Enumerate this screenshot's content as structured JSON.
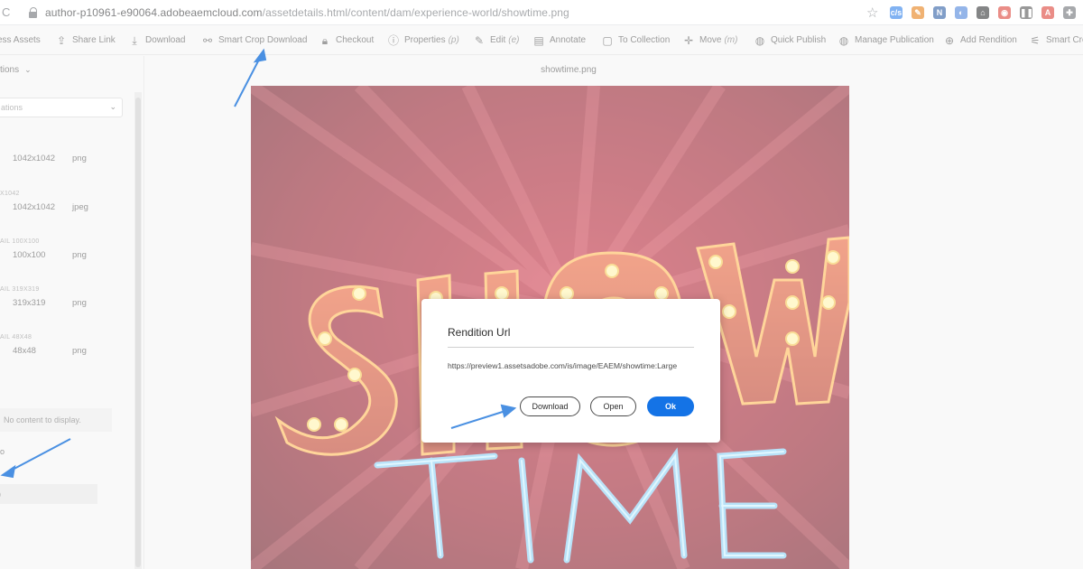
{
  "browser": {
    "reload_glyph": "C",
    "url_host": "author-p10961-e90064.adobeaemcloud.com",
    "url_path": "/assetdetails.html/content/dam/experience-world/showtime.png",
    "extensions": [
      {
        "name": "cjs-icon",
        "label": "c/s",
        "color": "#1a73e8"
      },
      {
        "name": "pen-icon",
        "label": "✎",
        "color": "#e37400"
      },
      {
        "name": "n-icon",
        "label": "N",
        "color": "#1b4f9c"
      },
      {
        "name": "circle-icon",
        "label": "◐",
        "color": "#3c78d8"
      },
      {
        "name": "home-icon",
        "label": "⌂",
        "color": "#202124"
      },
      {
        "name": "target-icon",
        "label": "◉",
        "color": "#d93025"
      },
      {
        "name": "pause-icon",
        "label": "❚❚",
        "color": "#444"
      },
      {
        "name": "adobe-icon",
        "label": "A",
        "color": "#d93025"
      },
      {
        "name": "puzzle-icon",
        "label": "✚",
        "color": "#5f6368"
      }
    ]
  },
  "toolbar": {
    "items": [
      {
        "name": "access-assets-button",
        "icon": "",
        "label": "cess Assets",
        "shortcut": ""
      },
      {
        "name": "share-link-button",
        "icon": "⇪",
        "label": "Share Link",
        "shortcut": ""
      },
      {
        "name": "download-button",
        "icon": "⤓",
        "label": "Download",
        "shortcut": ""
      },
      {
        "name": "smart-crop-download-button",
        "icon": "⚯",
        "label": "Smart Crop Download",
        "shortcut": ""
      },
      {
        "name": "checkout-button",
        "icon": "🔒︎",
        "label": "Checkout",
        "shortcut": ""
      },
      {
        "name": "properties-button",
        "icon": "ⓘ",
        "label": "Properties",
        "shortcut": "(p)"
      },
      {
        "name": "edit-button",
        "icon": "✎",
        "label": "Edit",
        "shortcut": "(e)"
      },
      {
        "name": "annotate-button",
        "icon": "▤",
        "label": "Annotate",
        "shortcut": ""
      },
      {
        "name": "to-collection-button",
        "icon": "▢",
        "label": "To Collection",
        "shortcut": ""
      },
      {
        "name": "move-button",
        "icon": "✛",
        "label": "Move",
        "shortcut": "(m)"
      },
      {
        "name": "quick-publish-button",
        "icon": "◍",
        "label": "Quick Publish",
        "shortcut": ""
      },
      {
        "name": "manage-publication-button",
        "icon": "◍",
        "label": "Manage Publication",
        "shortcut": ""
      },
      {
        "name": "add-rendition-button",
        "icon": "⊕",
        "label": "Add Rendition",
        "shortcut": ""
      },
      {
        "name": "smart-crop-button",
        "icon": "⚟",
        "label": "Smart Crop",
        "shortcut": ""
      }
    ]
  },
  "left_panel": {
    "title": "tions",
    "select_value": "ations",
    "renditions": [
      {
        "label": "",
        "size": "1042x1042",
        "format": "png"
      },
      {
        "label": "X1042",
        "size": "1042x1042",
        "format": "jpeg"
      },
      {
        "label": "AIL 100X100",
        "size": "100x100",
        "format": "png"
      },
      {
        "label": "AIL 319X319",
        "size": "319x319",
        "format": "png"
      },
      {
        "label": "AIL 48X48",
        "size": "48x48",
        "format": "png"
      }
    ],
    "no_content": "No content to display.",
    "mark_text": "o",
    "bar_text": ")"
  },
  "main": {
    "title": "showtime.png"
  },
  "dialog": {
    "title": "Rendition Url",
    "url": "https://preview1.assetsadobe.com/is/image/EAEM/showtime:Large",
    "download_label": "Download",
    "open_label": "Open",
    "ok_label": "Ok"
  },
  "colors": {
    "accent": "#1473e6",
    "annotation_arrow": "#4a90e2"
  }
}
